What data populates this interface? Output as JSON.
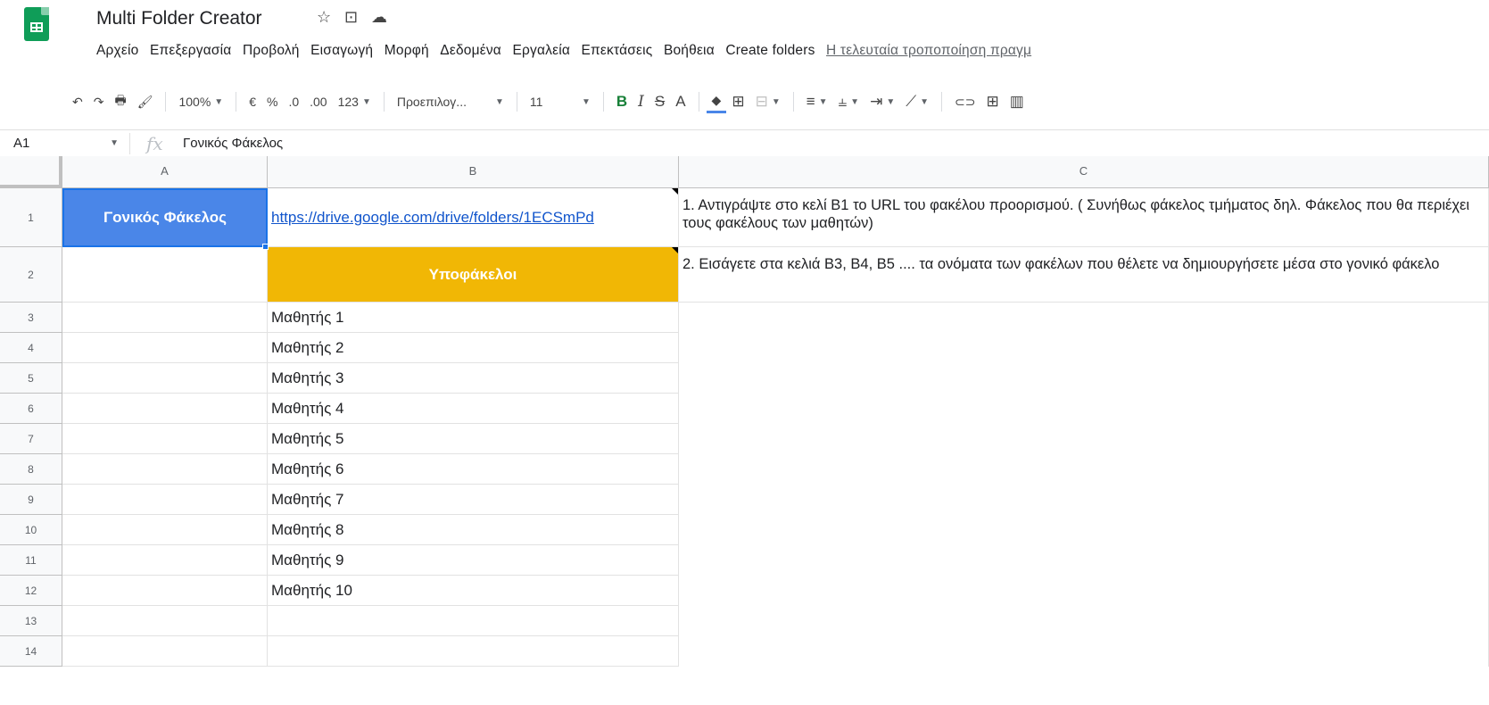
{
  "header": {
    "title": "Multi Folder Creator",
    "star_icon": "☆",
    "move_icon": "⊡",
    "cloud_icon": "☁",
    "menus": [
      "Αρχείο",
      "Επεξεργασία",
      "Προβολή",
      "Εισαγωγή",
      "Μορφή",
      "Δεδομένα",
      "Εργαλεία",
      "Επεκτάσεις",
      "Βοήθεια",
      "Create folders"
    ],
    "last_edit": "Η τελευταία τροποποίηση πραγμ"
  },
  "toolbar": {
    "undo": "↶",
    "redo": "↷",
    "print": "🖶",
    "paint_format": "🖌",
    "zoom": "100%",
    "currency": "€",
    "percent": "%",
    "decrease_decimals": ".0",
    "increase_decimals": ".00",
    "more_formats": "123",
    "font": "Προεπιλογ...",
    "font_size": "11",
    "bold": "B",
    "italic": "I",
    "strikethrough": "S",
    "text_color": "A",
    "fill_color": "◆",
    "borders": "⊞",
    "merge": "⊟",
    "align": "≡",
    "valign": "⫨",
    "wrap": "⇥",
    "rotate": "⟋",
    "link": "⊂⊃",
    "comment": "⊞",
    "chart": "▥"
  },
  "formula_bar": {
    "name_box": "A1",
    "fx": "fx",
    "content": "Γονικός Φάκελος"
  },
  "grid": {
    "columns": [
      "A",
      "B",
      "C"
    ],
    "rows": [
      "1",
      "2",
      "3",
      "4",
      "5",
      "6",
      "7",
      "8",
      "9",
      "10",
      "11",
      "12",
      "13",
      "14"
    ],
    "a1": "Γονικός Φάκελος",
    "b1": "https://drive.google.com/drive/folders/1ECSmPd",
    "c1": "1. Αντιγράψτε στο κελί B1 το URL του φακέλου προορισμού. ( Συνήθως φάκελος τμήματος δηλ. Φάκελος που θα περιέχει τους φακέλους των μαθητών)",
    "b2": "Υποφάκελοι",
    "c2": "2. Εισάγετε στα κελιά B3, B4, B5 .... τα ονόματα των φακέλων που θέλετε να δημιουργήσετε μέσα στο γονικό φάκελο",
    "students": [
      "Μαθητής 1",
      "Μαθητής 2",
      "Μαθητής 3",
      "Μαθητής 4",
      "Μαθητής 5",
      "Μαθητής 6",
      "Μαθητής 7",
      "Μαθητής 8",
      "Μαθητής 9",
      "Μαθητής 10"
    ]
  },
  "colors": {
    "parent_cell": "#4a86e8",
    "header_cell": "#f1b705",
    "link": "#1155cc",
    "logo": "#0f9d58"
  }
}
